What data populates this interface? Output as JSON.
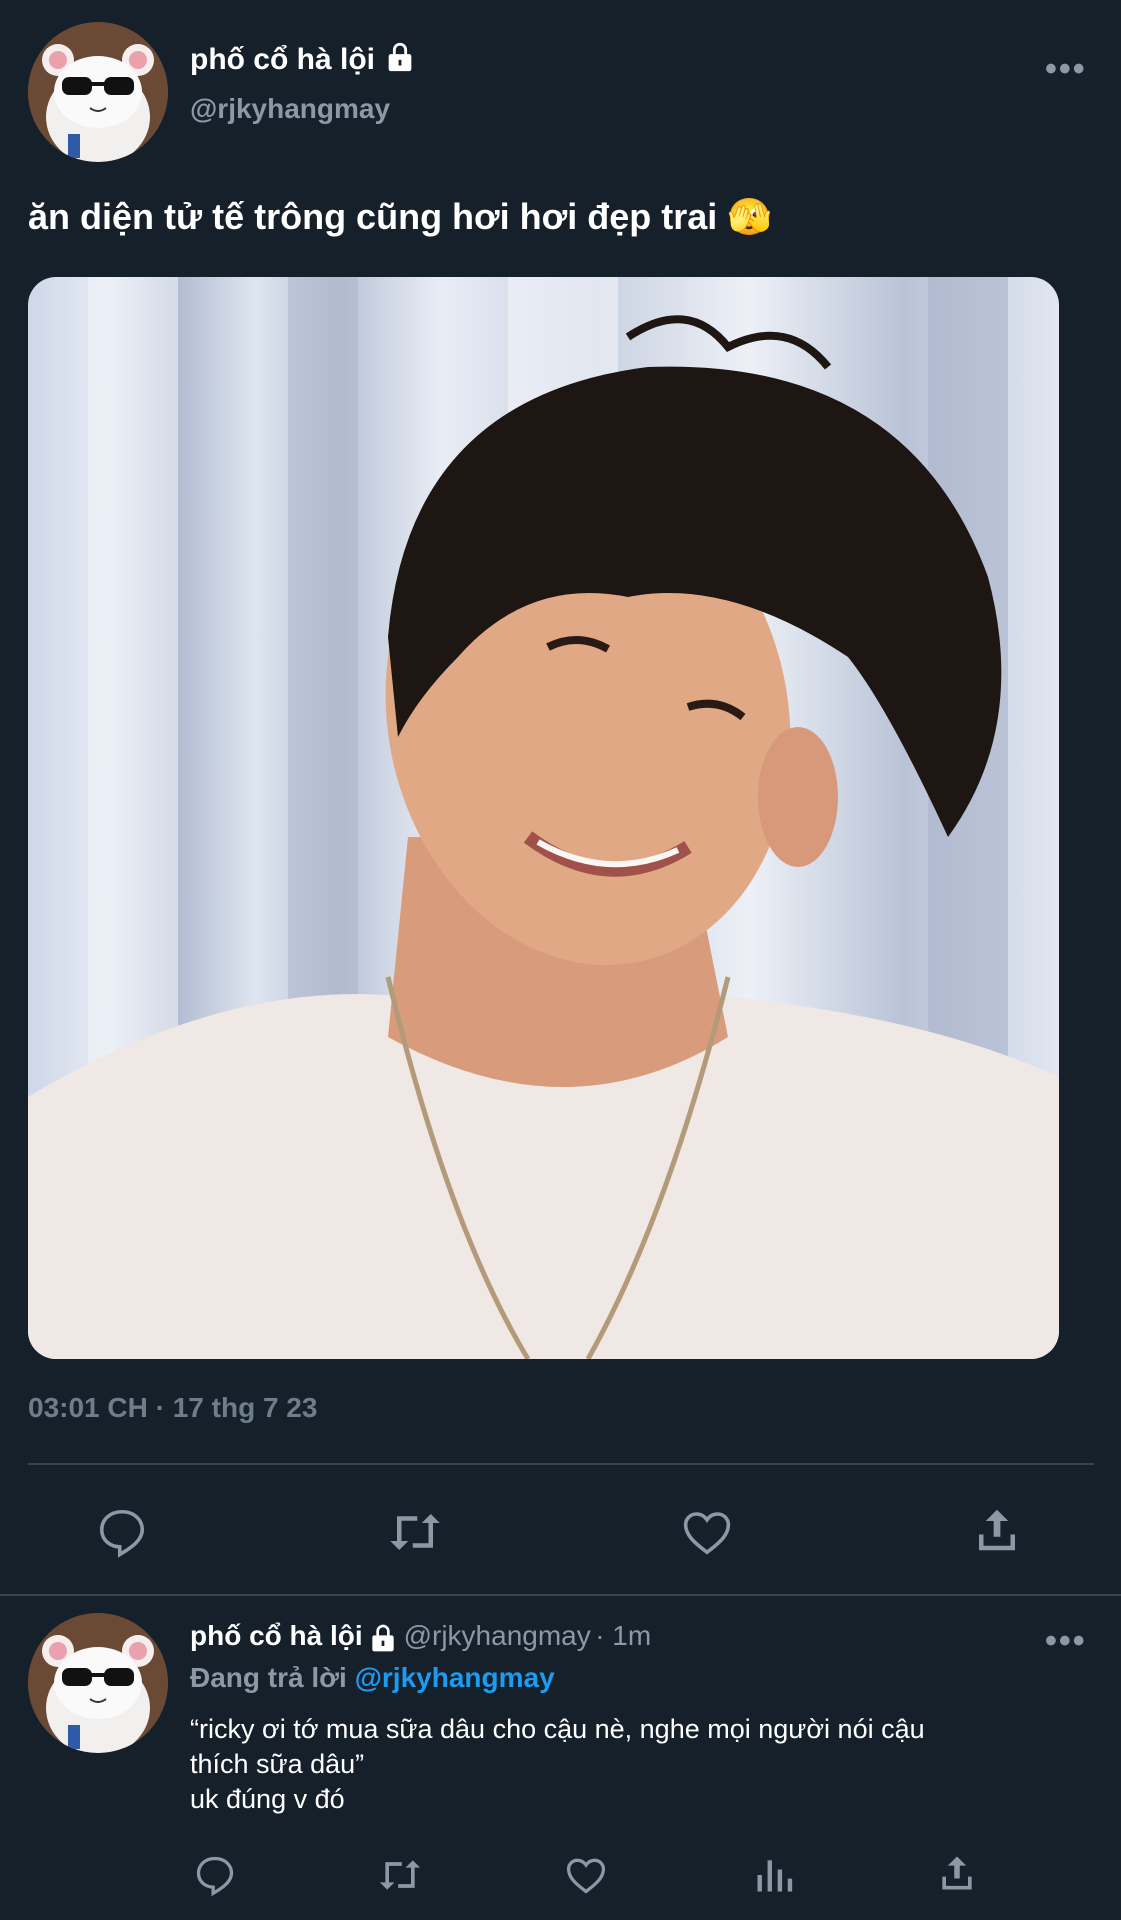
{
  "tweet": {
    "author_name": "phố cổ hà lội",
    "author_handle": "@rjkyhangmay",
    "text": "ăn diện tử tế trông cũng hơi hơi đẹp trai",
    "emoji": "🫣",
    "timestamp": "03:01 CH · 17 thg 7 23",
    "actions": [
      "reply-icon",
      "retweet-icon",
      "like-icon",
      "share-icon"
    ]
  },
  "reply": {
    "author_name": "phố cổ hà lội",
    "author_handle": "@rjkyhangmay",
    "time": "· 1m",
    "replying_label": "Đang trả lời",
    "replying_to": "@rjkyhangmay",
    "text_line1": "“ricky ơi tớ mua sữa dâu cho cậu nè, nghe mọi người nói cậu",
    "text_line2": "thích sữa dâu”",
    "text_line3": "uk đúng v đó",
    "actions": [
      "reply-icon",
      "retweet-icon",
      "like-icon",
      "analytics-icon",
      "share-icon"
    ]
  },
  "colors": {
    "background": "#15202b",
    "link": "#1d9bf0",
    "muted": "#8b98a5",
    "divider": "#38444d"
  }
}
